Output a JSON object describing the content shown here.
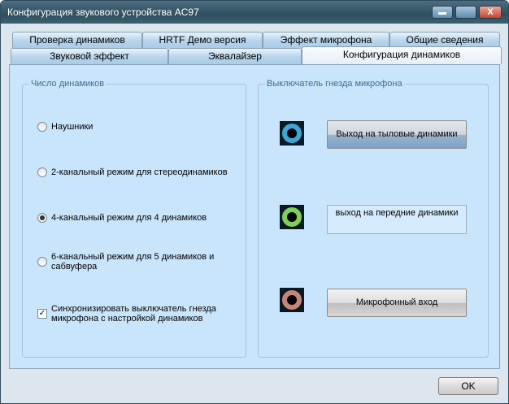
{
  "window": {
    "title": "Конфигурация звукового устройства AC97",
    "close_glyph": "X"
  },
  "tabs_row1": [
    "Проверка динамиков",
    "HRTF Демо версия",
    "Эффект микрофона",
    "Общие сведения"
  ],
  "tabs_row2": [
    "Звуковой эффект",
    "Эквалайзер",
    "Конфигурация динамиков"
  ],
  "active_tab": "Конфигурация динамиков",
  "speakers": {
    "label": "Число динамиков",
    "options": [
      {
        "label": "Наушники",
        "selected": false
      },
      {
        "label": "2-канальный режим для стереодинамиков",
        "selected": false
      },
      {
        "label": "4-канальный режим для 4 динамиков",
        "selected": true
      },
      {
        "label": "6-канальный режим для 5 динамиков и сабвуфера",
        "selected": false
      }
    ],
    "sync": {
      "label": "Синхронизировать выключатель гнезда микрофона с настройкой динамиков",
      "checked": true,
      "glyph": "✓"
    }
  },
  "jack_switch": {
    "label": "Выключатель гнезда микрофона",
    "rows": [
      {
        "label": "Выход на тыловые динамики",
        "color": "#3fa6d8"
      },
      {
        "label": "выход на передние динамики",
        "color": "#7fd05a"
      },
      {
        "label": "Микрофонный вход",
        "color": "#c7857a"
      }
    ]
  },
  "ok_label": "OK"
}
